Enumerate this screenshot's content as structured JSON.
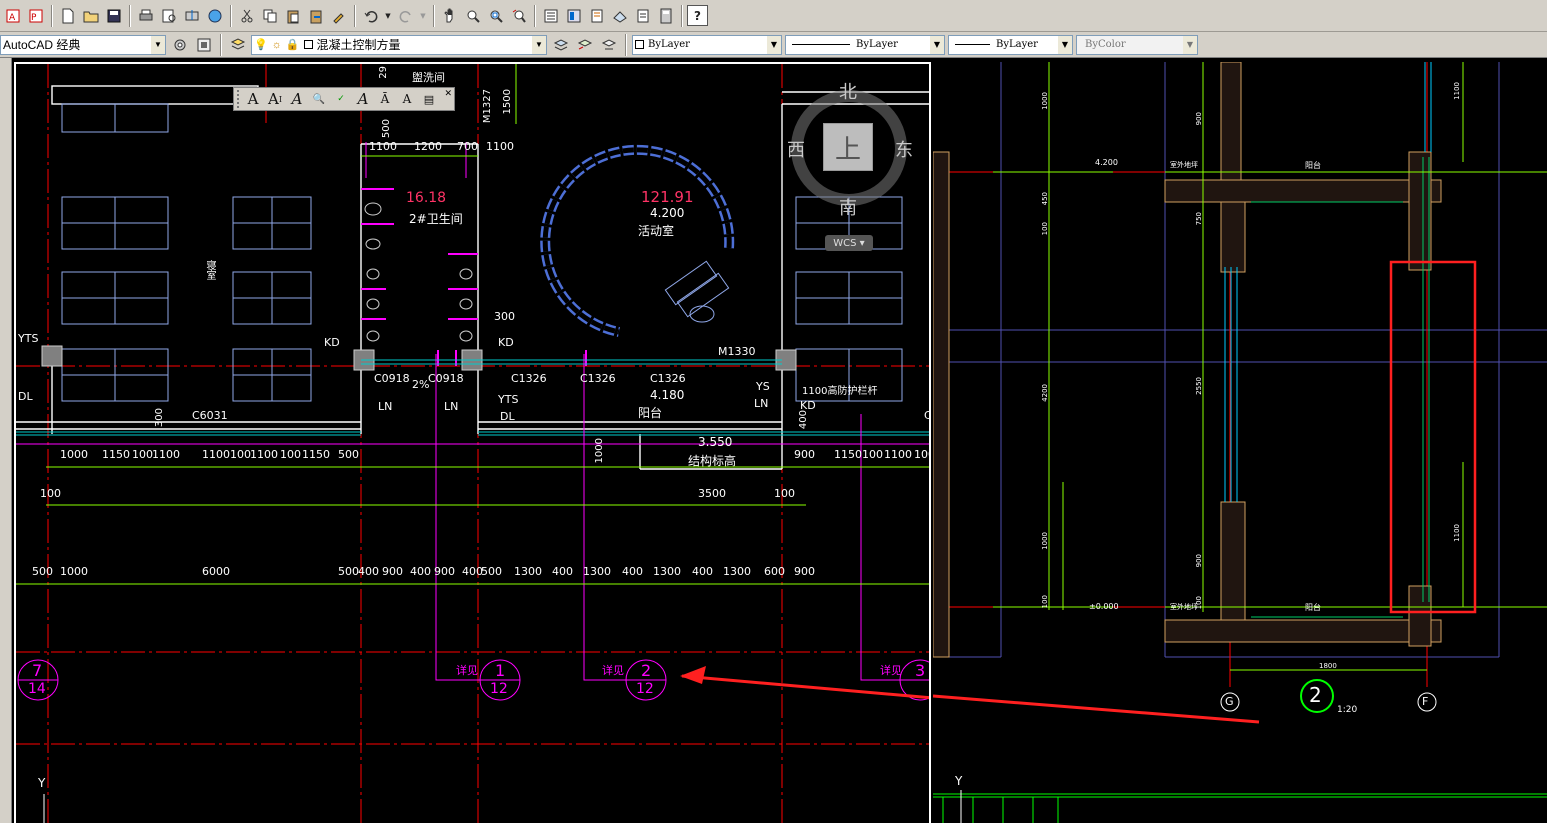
{
  "toolbar": {
    "workspace": "AutoCAD 经典",
    "layer": "混凝土控制方量",
    "color": "ByLayer",
    "linetype": "ByLayer",
    "lineweight": "ByLayer",
    "plotstyle": "ByColor"
  },
  "viewcube": {
    "north": "北",
    "south": "南",
    "east": "东",
    "west": "西",
    "top": "上",
    "wcs": "WCS"
  },
  "text_toolbar": {
    "icons": [
      "text-icon",
      "multiline-text-icon",
      "edit-text-icon",
      "find-icon",
      "spellcheck-icon",
      "text-style-icon",
      "scale-text-icon",
      "justify-text-icon",
      "text-convert-icon"
    ]
  },
  "drawing_left": {
    "rooms": {
      "laundry": "盥洗间",
      "wc_area": "16.18",
      "wc_name": "2#卫生间",
      "activity_area": "121.91",
      "activity_elev": "4.200",
      "activity_name": "活动室",
      "bedroom": "寝室",
      "balcony_elev": "4.180",
      "balcony": "阳台",
      "slab_elev": "3.550",
      "slab": "结构标高",
      "railing": "1100高防护栏杆"
    },
    "tags": {
      "m1327": "M1327",
      "m1330": "M1330",
      "kd": "KD",
      "yts": "YTS",
      "dl": "DL",
      "ys": "YS",
      "ln": "LN",
      "c6031": "C6031",
      "c0918": "C0918",
      "c1326": "C1326",
      "c": "C",
      "slope": "2%",
      "dim_1500": "1500",
      "dim_500_vert": "500",
      "dim_1000_vert": "1000",
      "dim_29": "29",
      "dim_1300": "1300",
      "dim_300": "300",
      "dim_400": "400"
    },
    "dims_top": [
      "1100",
      "1200",
      "700",
      "1100"
    ],
    "dims_row1": [
      "1000",
      "1150",
      "100",
      "1100",
      "1100",
      "100",
      "1100",
      "100",
      "1150",
      "500"
    ],
    "dims_row1_right": [
      "900",
      "1150",
      "100",
      "1100",
      "100"
    ],
    "dims_row2": [
      "3500",
      "100"
    ],
    "dims_row2_left": "100",
    "dims_row3": [
      "500",
      "1000",
      "6000",
      "500",
      "400",
      "900",
      "400",
      "900",
      "400",
      "500",
      "1300",
      "400",
      "1300",
      "400",
      "1300",
      "400",
      "1300",
      "600",
      "900"
    ],
    "details": [
      {
        "label": "详见",
        "top": "1",
        "bottom": "12"
      },
      {
        "label": "详见",
        "top": "2",
        "bottom": "12"
      },
      {
        "label": "详见",
        "top": "3",
        "bottom": ""
      }
    ],
    "grid_marker": {
      "top": "7",
      "bottom": "14"
    },
    "ucs": "Y"
  },
  "drawing_right": {
    "section_no": "2",
    "scale": "1:20",
    "axis_left": "G",
    "axis_right": "F",
    "elev_top": "4.200",
    "elev_bottom": "±0.000",
    "dims_vert": [
      "1000",
      "450",
      "4200",
      "1000",
      "100",
      "100"
    ],
    "dims_col2": [
      "900",
      "750",
      "2550",
      "900",
      "100"
    ],
    "dims_right": [
      "1100",
      "1100"
    ],
    "dim_width": "1800",
    "label_balcony": "阳台",
    "label_floor": "室外地坪",
    "ucs": "Y"
  },
  "colors": {
    "grid_red": "#ff0000",
    "dim_green": "#8aff00",
    "magenta": "#ff00ff",
    "cyan": "#00ffff",
    "blue_poly": "#4d6fd6",
    "highlight_red": "#ff2020"
  }
}
